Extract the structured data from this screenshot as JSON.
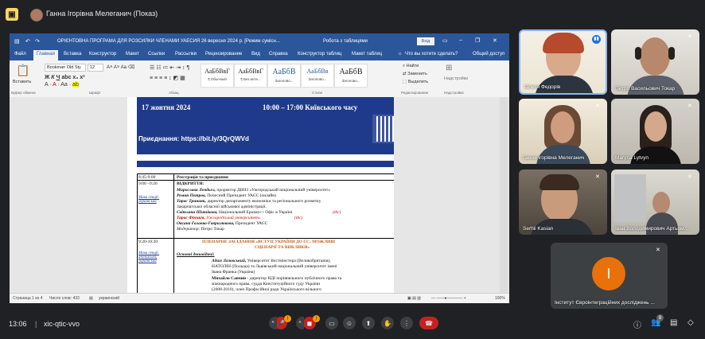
{
  "topbar": {
    "title": "Ганна Ігорівна Мелеганич (Показ)"
  },
  "word": {
    "title": "ОРІЄНТОВНА ПРОГРАМА ДЛЯ РОЗСИЛКИ ЧЛЕНАМИ УАЕСИЯ 26 вересня 2024 р. [Режим сумісн...",
    "context_tab": "Робота з таблицями",
    "signin": "Вхід",
    "tabs": [
      "Файл",
      "Главная",
      "Вставка",
      "Конструктор",
      "Макет",
      "Ссылки",
      "Рассылки",
      "Рецензирование",
      "Вид",
      "Справка",
      "Конструктор таблиц",
      "Макет таблиц"
    ],
    "tell_me": "Что вы хотите сделать?",
    "share": "Общий доступ",
    "ribbon": {
      "paste": "Вставить",
      "font_name": "Bookman Old Sty",
      "font_size": "12",
      "groups": [
        "Буфер обмена",
        "Шрифт",
        "Абзац",
        "Стили",
        "Редактирование",
        "Надстройки"
      ],
      "styles": [
        {
          "sample": "АаБбВвГ",
          "caption": "¶ Обычный"
        },
        {
          "sample": "АаБбВвГ",
          "caption": "¶ Без инте..."
        },
        {
          "sample": "АаБбВ",
          "caption": "Заголово..."
        },
        {
          "sample": "АаБбВв",
          "caption": "Заголово..."
        },
        {
          "sample": "АаБбВ",
          "caption": "Заголово..."
        }
      ],
      "find": "Найти",
      "replace": "Заменить",
      "select": "Выделить",
      "addins": "Надстройки"
    },
    "doc": {
      "date": "17 жовтня 2024",
      "time": "10:00 – 17:00 Київського часу",
      "join": "Приєднання: https://bit.ly/3QrQWVd",
      "rows": [
        {
          "time": "8:45-9:00",
          "text": "Реєстрація та приєднання"
        },
        {
          "time": "9:00 –9:20",
          "text": "ВІДКРИТТЯ:"
        }
      ],
      "lines": [
        {
          "b": "Мирослава Лендьел,",
          "t": " проректор ДВНЗ «Ужгородський національний університет»"
        },
        {
          "b": "Роман Петров,",
          "t": " Почесний Президент УАЄС (онлайн)"
        },
        {
          "b": "Тарас Тринаяк,",
          "t": " директор департаменту економіки та регіонального розвитку"
        },
        {
          "b": "",
          "t": "Закарпатської обласної військової адміністрації."
        },
        {
          "b": "Світлана Шитікова,",
          "t": " Національний Еразмус+ Офіс в Україні"
        },
        {
          "b": "Тарас Фіників,",
          "t": " Ужгородський університет»"
        },
        {
          "b": "Оксана Головко-Гаврилюкова,",
          "t": " Президент УАЄС"
        },
        {
          "b": "Модератор:",
          "t": " Петро Токар"
        }
      ],
      "tbc1": "(tbc)",
      "tbc2": "(tbc)",
      "side1": "Мова секції: українська",
      "side2": "Мова секції: англійська, українська",
      "plenary_time": "9:20-10:20",
      "plenary": "ПЛЕНАРНЕ ЗАСІДАННЯ «ВСТУП УКРАЇНИ ДО ЄС: МОЖЛИВІ",
      "plenary2": "СЦЕНАРІЇ ТА ВИКЛИКИ»",
      "speakers_label": "Основні доповідачі:",
      "speakers": [
        {
          "b": "Адам Лазовський,",
          "t": " Університет Вестмінстера (Великобританія),"
        },
        {
          "b": "",
          "t": "НАТОЛІН (Польща) та  Львівський національний університет імені"
        },
        {
          "b": "",
          "t": "Івана Франка (Україна)"
        },
        {
          "b": "Михайло Савчин",
          "t": " - директор НДІ порівняльного публічного права та"
        },
        {
          "b": "",
          "t": "міжнародного права, суддя Конституційного суду України"
        },
        {
          "b": "",
          "t": "(2008-2010), член Професійної ради Українського вільного"
        }
      ]
    },
    "status": {
      "page": "Страница 1 из 4",
      "words": "Число слов: 433",
      "lang": "украинский",
      "zoom": "100%"
    }
  },
  "participants": [
    {
      "name": "Олеся Федорів"
    },
    {
      "name": "Петро Васильович Токар"
    },
    {
      "name": "Ганна Ігорівна Мелеганич"
    },
    {
      "name": "Maryna Lytvyn"
    },
    {
      "name": "Serhii Kasian"
    },
    {
      "name": "Іван Володимирович Артьом..."
    },
    {
      "name": "Інститут Євроінтеграційних досліджень ...",
      "initial": "І"
    }
  ],
  "bottom": {
    "time": "13:06",
    "code": "xic-qtic-vvo",
    "participants_count": "8",
    "mic_badge": "!",
    "cam_badge": "!"
  },
  "colors": {
    "accent": "#2b579a",
    "banner": "#1f3a8a",
    "end_call": "#c5221f",
    "avatar": "#e8710a"
  }
}
